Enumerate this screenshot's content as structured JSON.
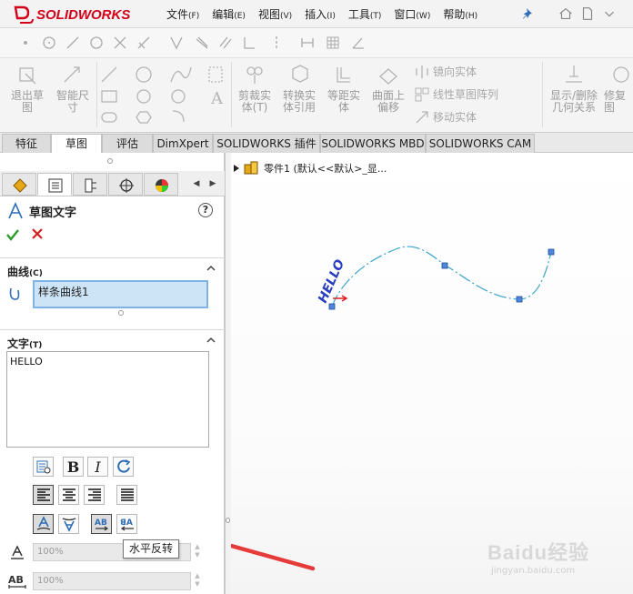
{
  "app": {
    "brand": "SOLIDWORKS",
    "brand_color": "#d4001a",
    "accent": "#2d6db5"
  },
  "menu": [
    {
      "label": "文件",
      "key": "(F)"
    },
    {
      "label": "编辑",
      "key": "(E)"
    },
    {
      "label": "视图",
      "key": "(V)"
    },
    {
      "label": "插入",
      "key": "(I)"
    },
    {
      "label": "工具",
      "key": "(T)"
    },
    {
      "label": "窗口",
      "key": "(W)"
    },
    {
      "label": "帮助",
      "key": "(H)"
    }
  ],
  "command_manager": {
    "exit_sketch": [
      "退出草",
      "图"
    ],
    "smart_dimension": [
      "智能尺",
      "寸"
    ],
    "trim": [
      "剪裁实",
      "体(T)"
    ],
    "convert": [
      "转换实",
      "体引用"
    ],
    "offset": [
      "等距实",
      "体"
    ],
    "offset_surface": [
      "曲面上",
      "偏移"
    ],
    "mirror": "镜向实体",
    "linear_pattern": "线性草图阵列",
    "move": "移动实体",
    "display_delete": [
      "显示/删除",
      "几何关系"
    ],
    "repair": [
      "修复",
      "图"
    ]
  },
  "tabs": [
    "特征",
    "草图",
    "评估",
    "DimXpert",
    "SOLIDWORKS 插件",
    "SOLIDWORKS MBD",
    "SOLIDWORKS CAM"
  ],
  "active_tab": "草图",
  "property_manager": {
    "title": "草图文字",
    "help": "?",
    "curve_section": {
      "label": "曲线",
      "key": "(C)",
      "item": "样条曲线1"
    },
    "text_section": {
      "label": "文字",
      "key": "(T)",
      "value": "HELLO"
    },
    "width_factor": "100%",
    "spacing": "100%",
    "tooltip": "水平反转"
  },
  "feature_tree": {
    "root": "零件1  (默认<<默认>_显..."
  },
  "sketch_text": "HELLO",
  "watermark": {
    "brand": "Baidu经验",
    "site": "jingyan.baidu.com"
  }
}
